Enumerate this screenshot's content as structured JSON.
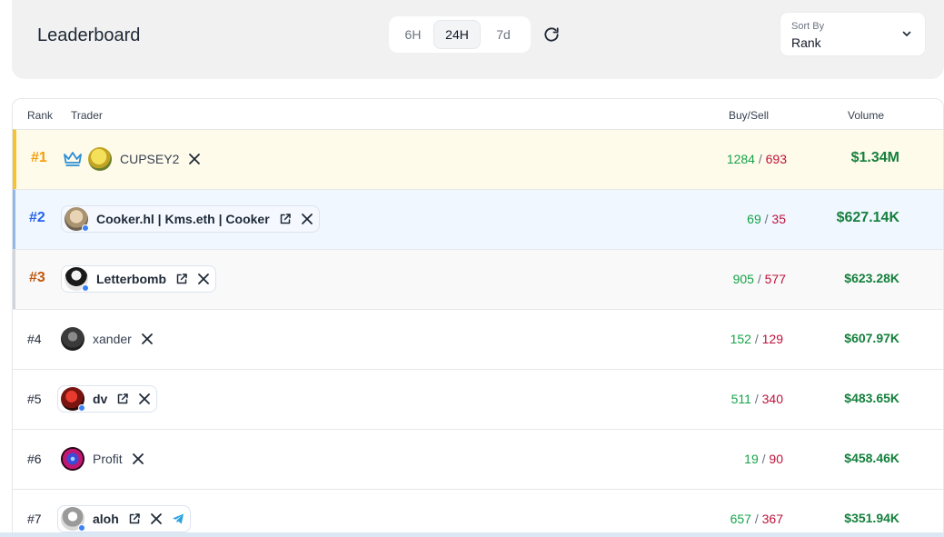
{
  "header": {
    "title": "Leaderboard",
    "tabs": [
      {
        "label": "6H",
        "active": false
      },
      {
        "label": "24H",
        "active": true
      },
      {
        "label": "7d",
        "active": false
      }
    ],
    "refresh_icon": "refresh-icon",
    "sort": {
      "label": "Sort By",
      "value": "Rank",
      "icon": "chevron-down-icon"
    }
  },
  "table": {
    "columns": {
      "rank": "Rank",
      "trader": "Trader",
      "buysell": "Buy/Sell",
      "volume": "Volume"
    },
    "rows": [
      {
        "rank": "#1",
        "name": "CUPSEY2",
        "buy": "1284",
        "sell": "693",
        "volume": "$1.34M"
      },
      {
        "rank": "#2",
        "name": "Cooker.hl | Kms.eth | Cooker",
        "buy": "69",
        "sell": "35",
        "volume": "$627.14K"
      },
      {
        "rank": "#3",
        "name": "Letterbomb",
        "buy": "905",
        "sell": "577",
        "volume": "$623.28K"
      },
      {
        "rank": "#4",
        "name": "xander",
        "buy": "152",
        "sell": "129",
        "volume": "$607.97K"
      },
      {
        "rank": "#5",
        "name": "dv",
        "buy": "511",
        "sell": "340",
        "volume": "$483.65K"
      },
      {
        "rank": "#6",
        "name": "Profit",
        "buy": "19",
        "sell": "90",
        "volume": "$458.46K"
      },
      {
        "rank": "#7",
        "name": "aloh",
        "buy": "657",
        "sell": "367",
        "volume": "$351.94K"
      }
    ],
    "separator": "/"
  },
  "colors": {
    "buy": "#16a34a",
    "sell": "#be123c",
    "volume": "#15803d",
    "rank1": "#f59e0b",
    "rank2": "#2563eb",
    "rank3": "#c2570c",
    "verified_dot": "#3b82f6"
  }
}
